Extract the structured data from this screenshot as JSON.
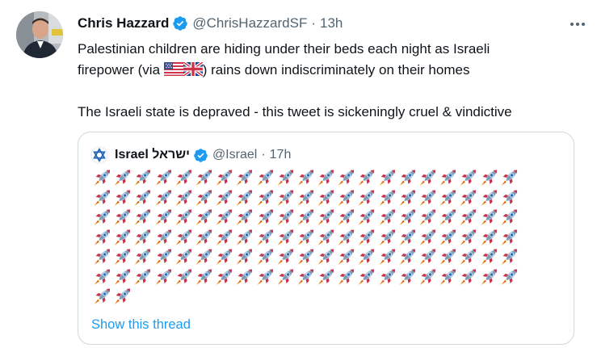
{
  "tweet": {
    "display_name": "Chris Hazzard",
    "handle": "@ChrisHazzardSF",
    "separator": "·",
    "time": "13h",
    "text_line1": "Palestinian children are hiding under their beds each night as Israeli",
    "text_line2_pre": "firepower (via ",
    "text_line2_flags": [
      "flag-us-icon",
      "flag-gb-icon"
    ],
    "text_line2_post": ") rains down indiscriminately on their homes",
    "text_line3": "The Israeli state is depraved - this tweet is sickeningly cruel & vindictive"
  },
  "quoted_tweet": {
    "display_name": "Israel ישראל",
    "handle": "@Israel",
    "separator": "·",
    "time": "17h",
    "rocket_rows": [
      21,
      21,
      21,
      21,
      21,
      21,
      2
    ],
    "rocket_icon": "rocket-icon",
    "show_thread_label": "Show this thread"
  },
  "colors": {
    "accent": "#1d9bf0",
    "text": "#0f1419",
    "muted": "#536471",
    "border": "#cfd9de"
  }
}
